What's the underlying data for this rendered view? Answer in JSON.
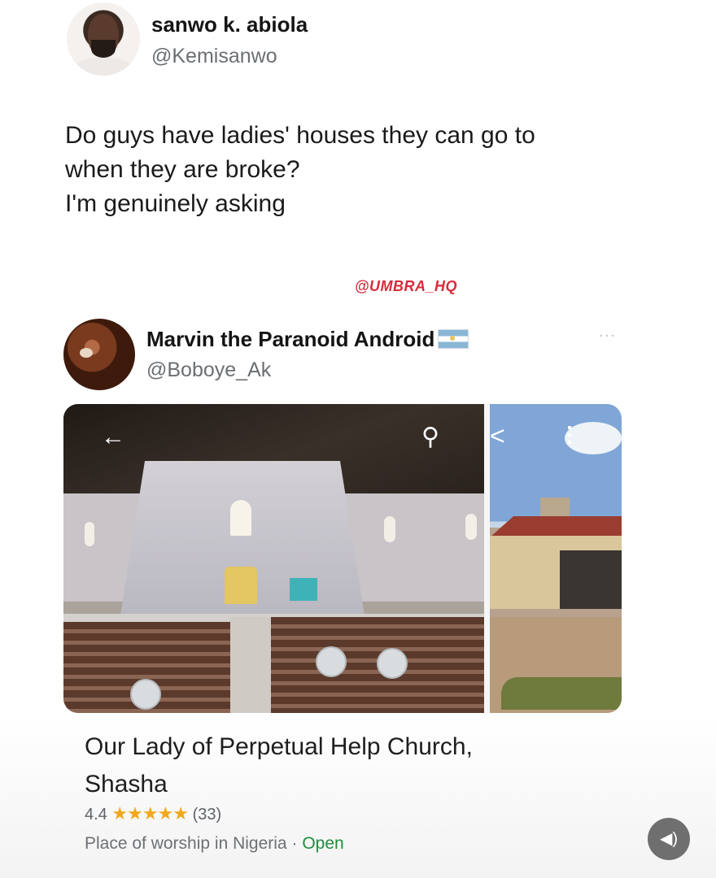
{
  "tweet1": {
    "name": "sanwo k. abiola",
    "handle": "@Kemisanwo",
    "lines": [
      "Do guys have ladies' houses they can go to",
      "when they are broke?",
      "I'm genuinely asking"
    ]
  },
  "watermark": "@UMBRA_HQ",
  "tweet2": {
    "name": "Marvin the Paranoid Android",
    "handle": "@Boboye_Ak",
    "more": "···"
  },
  "icons": {
    "back": "←",
    "search": "⚲",
    "share": "<",
    "menu": "…",
    "sound": "◀)"
  },
  "place": {
    "title_line1": "Our Lady of Perpetual Help Church,",
    "title_line2": "Shasha",
    "rating": "4.4",
    "stars": "★★★★★",
    "reviews": "(33)",
    "type": "Place of worship in Nigeria",
    "separator": "·",
    "status": "Open"
  },
  "colors": {
    "watermark": "#d62c3a",
    "stars": "#f2a81d",
    "open_status": "#1e8e3e"
  }
}
